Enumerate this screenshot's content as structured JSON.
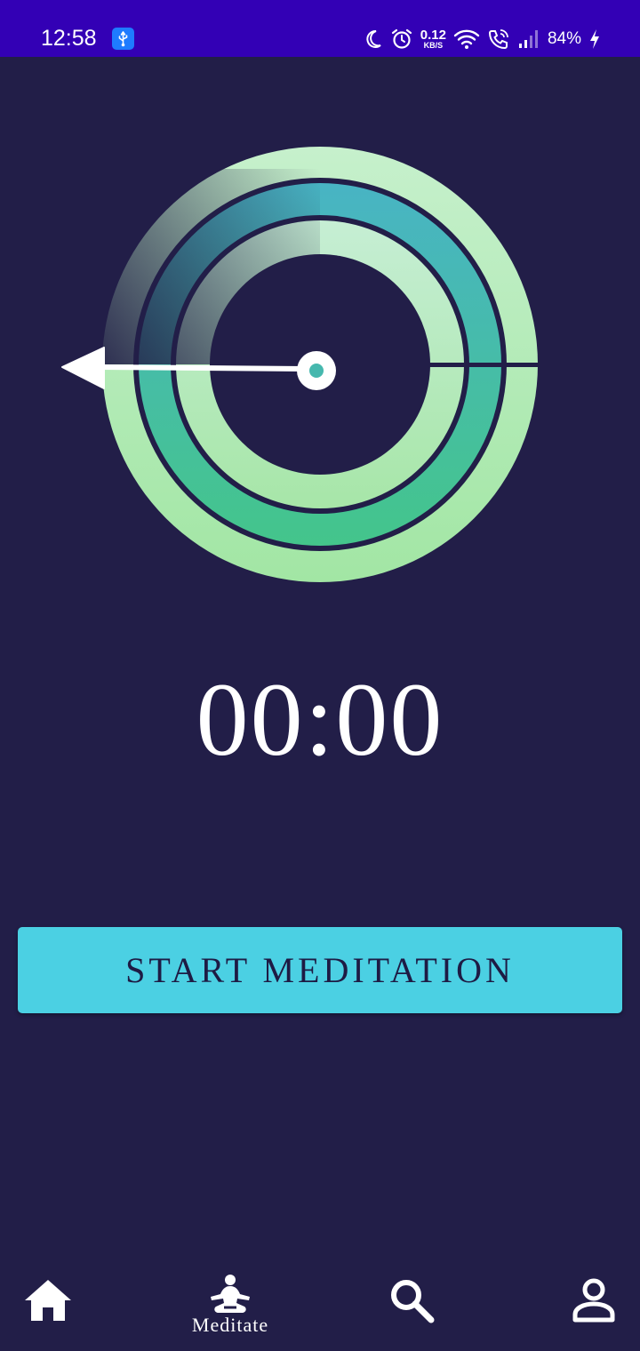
{
  "status_bar": {
    "time": "12:58",
    "net_speed_value": "0.12",
    "net_speed_unit": "KB/S",
    "battery": "84%",
    "icons": [
      "usb-icon",
      "moon-icon",
      "alarm-icon",
      "wifi-icon",
      "wifi-call-icon",
      "signal-icon",
      "charging-icon"
    ]
  },
  "timer": {
    "display": "00:00"
  },
  "actions": {
    "start_label": "START MEDITATION"
  },
  "bottom_nav": {
    "items": [
      {
        "icon": "home-icon",
        "label": ""
      },
      {
        "icon": "meditate-icon",
        "label": "Meditate"
      },
      {
        "icon": "search-icon",
        "label": ""
      },
      {
        "icon": "profile-icon",
        "label": ""
      }
    ]
  },
  "colors": {
    "background": "#221e48",
    "status_bar": "#3300b5",
    "button": "#4bd0e3",
    "outer_ring": "#c3eec4",
    "middle_ring": "#44b7c1",
    "inner_ring": "#b7ebc0"
  }
}
